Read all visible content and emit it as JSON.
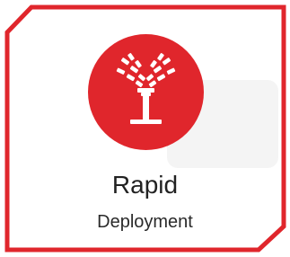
{
  "card": {
    "title": "Rapid",
    "subtitle": "Deployment",
    "icon": "sprinkler-icon"
  },
  "colors": {
    "accent": "#e0262c",
    "frame": "#e0262c",
    "icon": "#ffffff",
    "text": "#222222",
    "panel": "#f4f4f4"
  }
}
